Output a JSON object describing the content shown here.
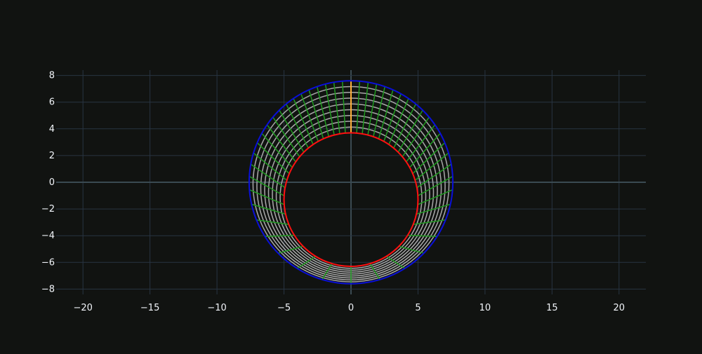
{
  "chart_data": {
    "type": "line",
    "title": "",
    "xlabel": "",
    "ylabel": "",
    "xlim": [
      -22,
      22
    ],
    "ylim": [
      -8.4,
      8.4
    ],
    "x_ticks": [
      -20,
      -15,
      -10,
      -5,
      0,
      5,
      10,
      15,
      20
    ],
    "y_ticks": [
      8,
      6,
      4,
      2,
      0,
      -2,
      -4,
      -6,
      -8
    ],
    "x_tick_labels": [
      "−20",
      "−15",
      "−10",
      "−5",
      "0",
      "5",
      "10",
      "15",
      "20"
    ],
    "y_tick_labels": [
      "8",
      "6",
      "4",
      "2",
      "0",
      "−2",
      "−4",
      "−6",
      "−8"
    ],
    "grid": true,
    "legend": false,
    "colors": {
      "background": "#111311",
      "grid": "#283442",
      "zeroline": "#3a4a52",
      "outer_circle": "#0a10d8",
      "inner_circle": "#ff1111",
      "contour_lines": "#a9a9a9",
      "field_lines": "#1f9a1f",
      "cut_line": "#ffb13b",
      "tick_text": "#f2f5fa"
    },
    "outer_circle": {
      "cx": 0,
      "cy": 0,
      "r": 7.6
    },
    "inner_circle": {
      "cx": 0,
      "cy": -1.3,
      "r": 5.0
    },
    "contour_count": 8,
    "field_line_count": 48,
    "cut_line": {
      "x": 0,
      "y_from": 3.7,
      "y_to": 7.6
    }
  }
}
